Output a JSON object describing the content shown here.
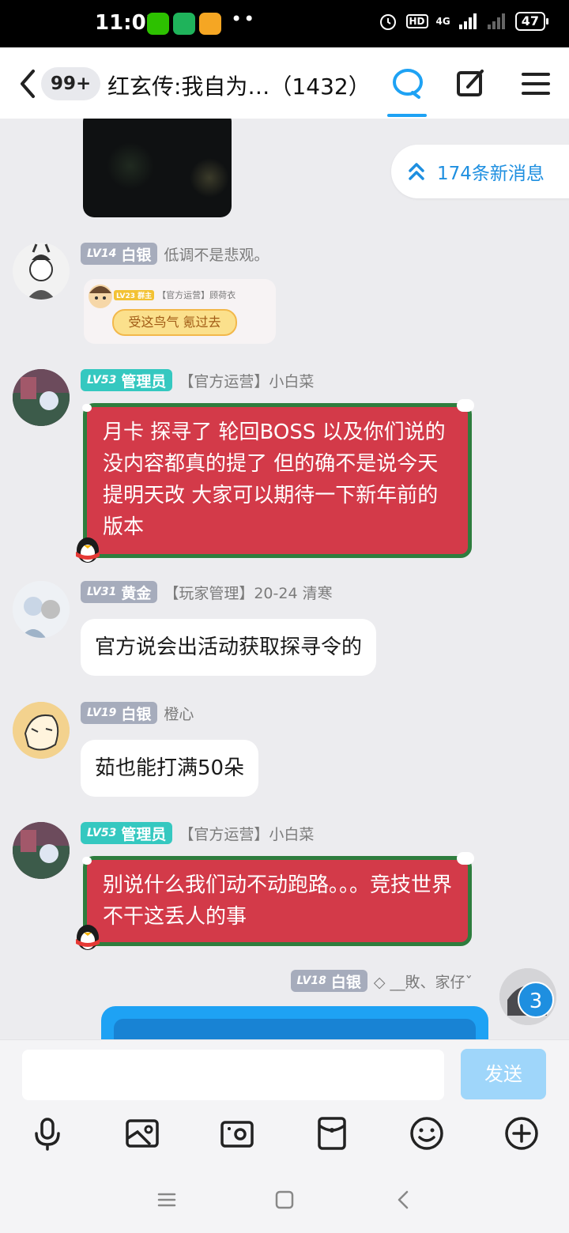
{
  "status_bar": {
    "time": "11:02",
    "dots": "••",
    "network": "4G",
    "hd": "HD",
    "battery": "47"
  },
  "header": {
    "back_badge": "99+",
    "title": "红玄传:我自为…（1432）"
  },
  "new_messages": "174条新消息",
  "messages": [
    {
      "level": "LV14",
      "rank": "白银",
      "name": "低调不是悲观。",
      "sticker": {
        "mini_level": "LV23 群主",
        "mini_name": "【官方运营】顾荷衣",
        "text": "受这鸟气 氪过去"
      }
    },
    {
      "level": "LV53",
      "rank": "管理员",
      "name": "【官方运营】小白菜",
      "text": "月卡 探寻了 轮回BOSS 以及你们说的没内容都真的提了 但的确不是说今天提明天改 大家可以期待一下新年前的版本"
    },
    {
      "level": "LV31",
      "rank": "黄金",
      "name": "【玩家管理】20-24 清寒",
      "text": "官方说会出活动获取探寻令的"
    },
    {
      "level": "LV19",
      "rank": "白银",
      "name": "橙心",
      "text": "茹也能打满50朵"
    },
    {
      "level": "LV53",
      "rank": "管理员",
      "name": "【官方运营】小白菜",
      "text": "别说什么我们动不动跑路。。。竞技世界不干这丢人的事"
    },
    {
      "level": "LV18",
      "rank": "白银",
      "name": "◇ __敗、家仔ˇ",
      "unread": "3"
    }
  ],
  "input": {
    "send_label": "发送"
  },
  "colors": {
    "accent": "#1ea2f4",
    "admin_badge": "#35c8c0",
    "silver_badge": "#a6acbc",
    "red_bubble": "#d33a49",
    "red_bubble_border": "#2e7d3e"
  }
}
